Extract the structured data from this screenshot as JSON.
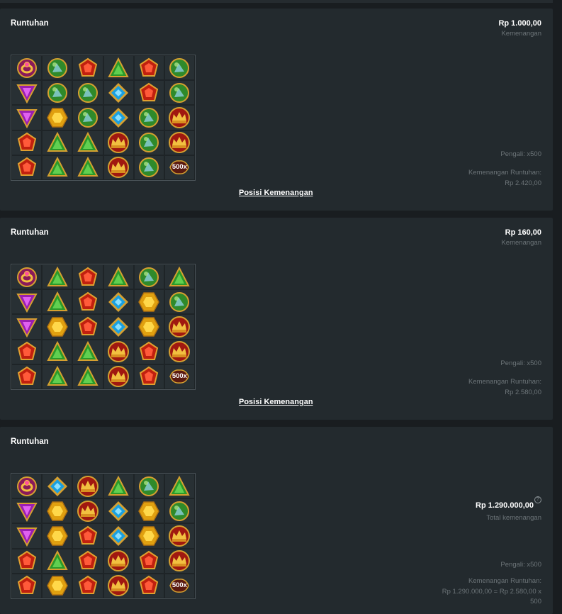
{
  "rounds": [
    {
      "title": "Runtuhan",
      "amount": "Rp 1.000,00",
      "amount_label": "Kemenangan",
      "multiplier": "Pengali: x500",
      "cascade_win_label": "Kemenangan Runtuhan:",
      "cascade_win_value": "Rp 2.420,00",
      "win_positions_link": "Posisi Kemenangan",
      "grid": [
        [
          "ring-icon",
          "green-orb-icon",
          "red-gem-icon",
          "green-triangle-icon",
          "red-gem-icon",
          "green-orb-icon"
        ],
        [
          "purple-triangle-icon",
          "green-orb-icon",
          "green-orb-icon",
          "blue-diamond-icon",
          "red-gem-icon",
          "green-orb-icon"
        ],
        [
          "purple-triangle-icon",
          "yellow-hex-icon",
          "green-orb-icon",
          "blue-diamond-icon",
          "green-orb-icon",
          "crown-icon"
        ],
        [
          "red-gem-icon",
          "green-triangle-icon",
          "green-triangle-icon",
          "crown-icon",
          "green-orb-icon",
          "crown-icon"
        ],
        [
          "red-gem-icon",
          "green-triangle-icon",
          "green-triangle-icon",
          "crown-icon",
          "green-orb-icon",
          "multiplier-500x-icon"
        ]
      ]
    },
    {
      "title": "Runtuhan",
      "amount": "Rp 160,00",
      "amount_label": "Kemenangan",
      "multiplier": "Pengali: x500",
      "cascade_win_label": "Kemenangan Runtuhan:",
      "cascade_win_value": "Rp 2.580,00",
      "win_positions_link": "Posisi Kemenangan",
      "grid": [
        [
          "ring-icon",
          "green-triangle-icon",
          "red-gem-icon",
          "green-triangle-icon",
          "green-orb-icon",
          "green-triangle-icon"
        ],
        [
          "purple-triangle-icon",
          "green-triangle-icon",
          "red-gem-icon",
          "blue-diamond-icon",
          "yellow-hex-icon",
          "green-orb-icon"
        ],
        [
          "purple-triangle-icon",
          "yellow-hex-icon",
          "red-gem-icon",
          "blue-diamond-icon",
          "yellow-hex-icon",
          "crown-icon"
        ],
        [
          "red-gem-icon",
          "green-triangle-icon",
          "green-triangle-icon",
          "crown-icon",
          "red-gem-icon",
          "crown-icon"
        ],
        [
          "red-gem-icon",
          "green-triangle-icon",
          "green-triangle-icon",
          "crown-icon",
          "red-gem-icon",
          "multiplier-500x-icon"
        ]
      ]
    },
    {
      "title": "Runtuhan",
      "total_amount": "Rp 1.290.000,00",
      "total_label": "Total kemenangan",
      "multiplier": "Pengali: x500",
      "cascade_win_label": "Kemenangan Runtuhan:",
      "cascade_win_value": "Rp 1.290.000,00 = Rp 2.580,00 x 500",
      "grid": [
        [
          "ring-icon",
          "blue-diamond-icon",
          "crown-icon",
          "green-triangle-icon",
          "green-orb-icon",
          "green-triangle-icon"
        ],
        [
          "purple-triangle-icon",
          "yellow-hex-icon",
          "crown-icon",
          "blue-diamond-icon",
          "yellow-hex-icon",
          "green-orb-icon"
        ],
        [
          "purple-triangle-icon",
          "yellow-hex-icon",
          "red-gem-icon",
          "blue-diamond-icon",
          "yellow-hex-icon",
          "crown-icon"
        ],
        [
          "red-gem-icon",
          "green-triangle-icon",
          "red-gem-icon",
          "crown-icon",
          "red-gem-icon",
          "crown-icon"
        ],
        [
          "red-gem-icon",
          "yellow-hex-icon",
          "red-gem-icon",
          "crown-icon",
          "red-gem-icon",
          "multiplier-500x-icon"
        ]
      ]
    }
  ],
  "multiplier_symbol_text": "500x",
  "help_icon_glyph": "?",
  "colors": {
    "background": "#191d20",
    "panel": "#232a2e",
    "text_primary": "#ffffff",
    "text_muted": "#6c7478"
  }
}
